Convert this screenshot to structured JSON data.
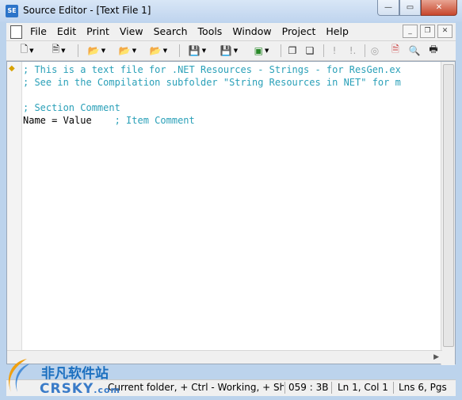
{
  "window": {
    "title": "Source Editor - [Text File 1]",
    "app_icon": "SE"
  },
  "menu": {
    "items": [
      "File",
      "Edit",
      "Print",
      "View",
      "Search",
      "Tools",
      "Window",
      "Project",
      "Help"
    ]
  },
  "editor": {
    "lines": [
      {
        "type": "comment",
        "text": "; This is a text file for .NET Resources - Strings - for ResGen.ex"
      },
      {
        "type": "comment",
        "text": "; See in the Compilation subfolder \"String Resources in NET\" for m"
      },
      {
        "type": "blank",
        "text": ""
      },
      {
        "type": "comment",
        "text": "; Section Comment"
      },
      {
        "type": "code",
        "text": "Name = Value",
        "comment": "    ; Item Comment"
      }
    ]
  },
  "status": {
    "hint": "Current folder, + Ctrl - Working, + Sh",
    "code": "059 : 3B",
    "position": "Ln 1, Col 1",
    "lines": "Lns 6, Pgs"
  },
  "watermark": {
    "cn": "非凡软件站",
    "en": "CRSKY",
    "en_suffix": ".com"
  }
}
